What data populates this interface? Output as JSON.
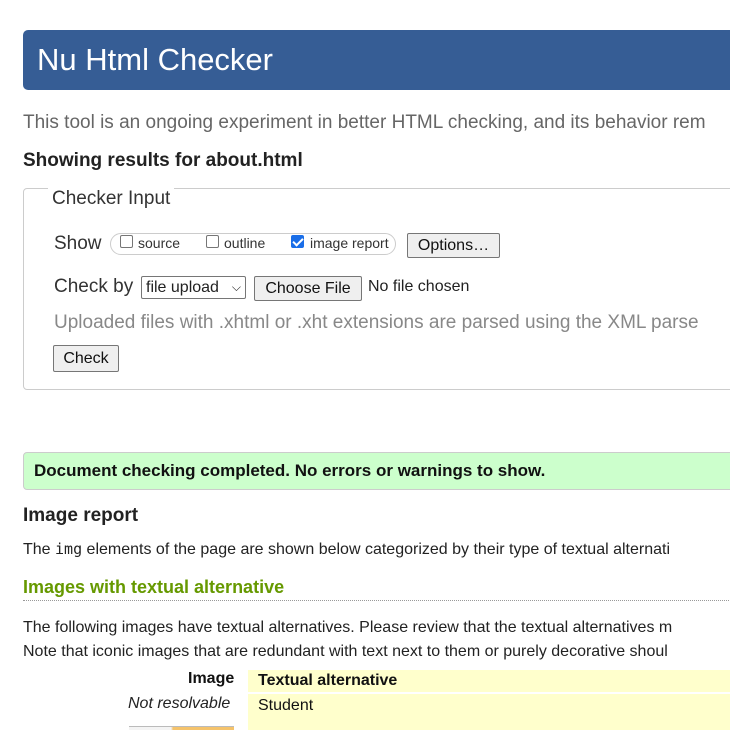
{
  "header": {
    "title": "Nu Html Checker"
  },
  "intro": {
    "text": "This tool is an ongoing experiment in better HTML checking, and its behavior rem"
  },
  "results_for": {
    "text": "Showing results for about.html"
  },
  "checker_input": {
    "legend": "Checker Input",
    "show_label": "Show",
    "options": [
      {
        "label": "source",
        "checked": false
      },
      {
        "label": "outline",
        "checked": false
      },
      {
        "label": "image report",
        "checked": true
      }
    ],
    "options_button": "Options…",
    "check_by_label": "Check by",
    "check_by_selected": "file upload",
    "choose_file_button": "Choose File",
    "no_file_text": "No file chosen",
    "note": "Uploaded files with .xhtml or .xht extensions are parsed using the XML parse",
    "check_button": "Check"
  },
  "status": {
    "message": "Document checking completed. No errors or warnings to show.",
    "color": "#ccffcc"
  },
  "image_report": {
    "heading": "Image report",
    "desc_before": "The ",
    "desc_code": "img",
    "desc_after": " elements of the page are shown below categorized by their type of textual alternati",
    "section_heading": "Images with textual alternative",
    "section_heading_color": "#669900",
    "para1": "The following images have textual alternatives. Please review that the textual alternatives m",
    "para2": "Note that iconic images that are redundant with text next to them or purely decorative shoul",
    "table": {
      "col_image": "Image",
      "col_alt": "Textual alternative",
      "rows": [
        {
          "image": "Not resolvable",
          "alt": "Student"
        }
      ]
    }
  },
  "colors": {
    "banner": "#365d95",
    "alt_cell": "#ffffcc"
  }
}
